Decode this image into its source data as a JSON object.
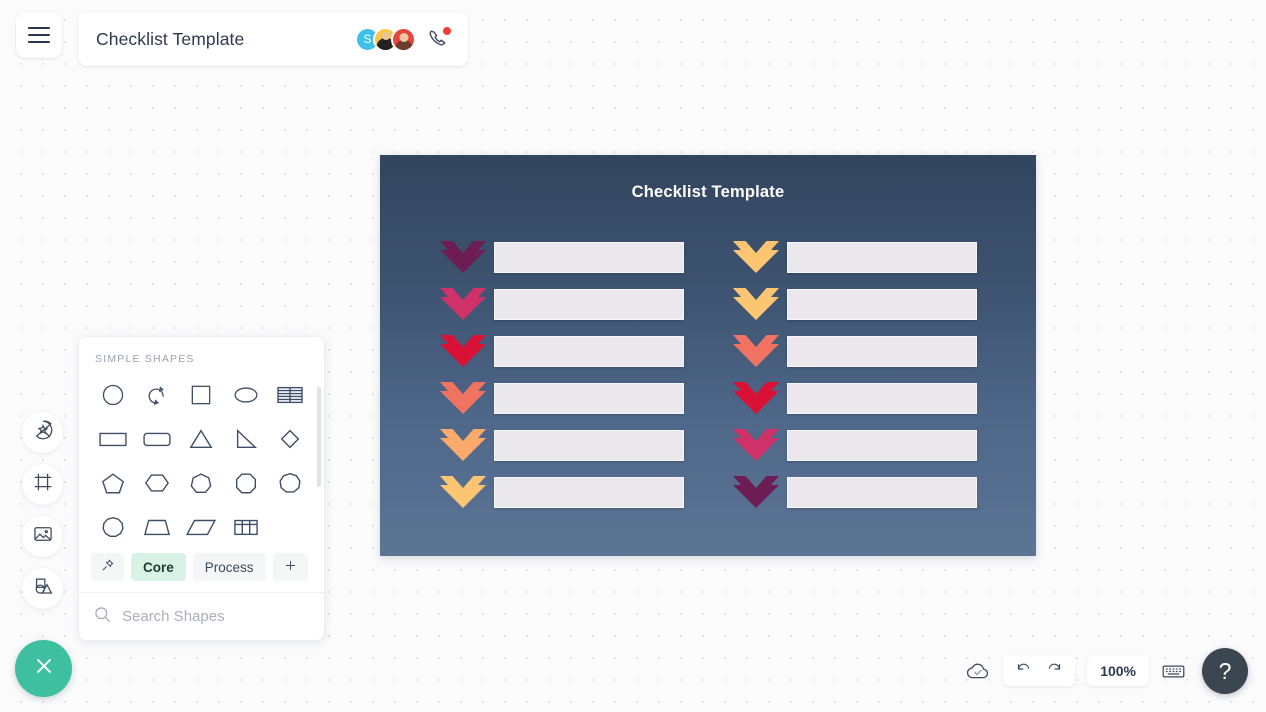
{
  "app": {
    "document_title": "Checklist Template",
    "menu_icon": "hamburger-menu-icon"
  },
  "collaborators": [
    {
      "initial": "S",
      "kind": "initial-avatar",
      "color": "#3fc0e8"
    },
    {
      "initial": "",
      "kind": "photo-avatar",
      "color": "#fcc64a"
    },
    {
      "initial": "",
      "kind": "photo-avatar",
      "color": "#e8453c"
    }
  ],
  "call": {
    "icon": "phone-call-icon",
    "badge_color": "#ef3e36"
  },
  "left_rail": [
    {
      "icon": "sticker-star-icon",
      "label": "Stickers"
    },
    {
      "icon": "frame-icon",
      "label": "Frames"
    },
    {
      "icon": "image-icon",
      "label": "Images"
    },
    {
      "icon": "shapes-icon",
      "label": "Shapes"
    }
  ],
  "close_fab": {
    "icon": "close-x-icon",
    "color": "#3dbfa0"
  },
  "shapes_panel": {
    "header": "SIMPLE SHAPES",
    "shapes": [
      "circle",
      "arc-spiral",
      "square",
      "ellipse",
      "striped-table",
      "rectangle",
      "rounded-rectangle",
      "triangle",
      "right-triangle",
      "diamond",
      "pentagon",
      "hexagon",
      "heptagon",
      "octagon",
      "nonagon",
      "decagon",
      "trapezoid",
      "parallelogram",
      "grid-table"
    ],
    "tabs": [
      {
        "label": "",
        "icon": "pin-icon",
        "active": false
      },
      {
        "label": "Core",
        "icon": "",
        "active": true
      },
      {
        "label": "Process",
        "icon": "",
        "active": false
      },
      {
        "label": "+",
        "icon": "plus-icon",
        "active": false
      }
    ],
    "search": {
      "placeholder": "Search Shapes",
      "value": "",
      "icon": "search-icon",
      "more_icon": "kebab-menu-icon"
    }
  },
  "diagram": {
    "title": "Checklist Template",
    "background_gradient": [
      "#32455e",
      "#5c7595"
    ],
    "bar_color": "#eae8ec",
    "left_column": [
      {
        "chevron_color": "#6d1d53",
        "text": ""
      },
      {
        "chevron_color": "#cf3268",
        "text": ""
      },
      {
        "chevron_color": "#d91134",
        "text": ""
      },
      {
        "chevron_color": "#f07261",
        "text": ""
      },
      {
        "chevron_color": "#fba96c",
        "text": ""
      },
      {
        "chevron_color": "#fcc572",
        "text": ""
      }
    ],
    "right_column": [
      {
        "chevron_color": "#fcc572",
        "text": ""
      },
      {
        "chevron_color": "#fcc572",
        "text": ""
      },
      {
        "chevron_color": "#f07261",
        "text": ""
      },
      {
        "chevron_color": "#d91134",
        "text": ""
      },
      {
        "chevron_color": "#cf3268",
        "text": ""
      },
      {
        "chevron_color": "#6d1d53",
        "text": ""
      }
    ]
  },
  "bottom_toolbar": {
    "cloud_icon": "cloud-saved-icon",
    "undo_icon": "undo-icon",
    "redo_icon": "redo-icon",
    "zoom_level": "100%",
    "keyboard_icon": "keyboard-icon",
    "help_label": "?"
  }
}
